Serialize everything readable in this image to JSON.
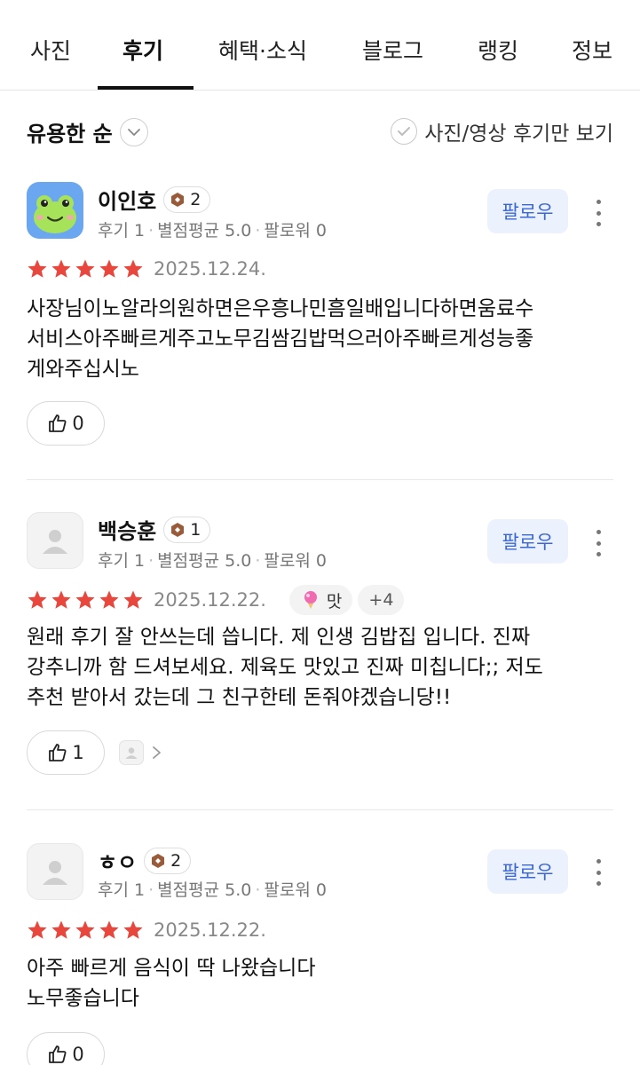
{
  "tabs": [
    {
      "label": "사진"
    },
    {
      "label": "후기"
    },
    {
      "label": "혜택·소식"
    },
    {
      "label": "블로그"
    },
    {
      "label": "랭킹"
    },
    {
      "label": "정보"
    }
  ],
  "active_tab": "후기",
  "sort": {
    "label": "유용한 순"
  },
  "photo_filter": {
    "label": "사진/영상 후기만 보기"
  },
  "follow_label": "팔로우",
  "colors": {
    "star": "#e8473e",
    "follow_bg": "#ebf1fd",
    "follow_text": "#3b67d6",
    "level_badge": "#9a5b3b"
  },
  "reviews": [
    {
      "name": "이인호",
      "level": "2",
      "meta": [
        "후기 1",
        "별점평균 5.0",
        "팔로워 0"
      ],
      "rating": 5,
      "date": "2025.12.24.",
      "keyword": "",
      "keyword_more": "",
      "text": "사장님이노알라의원하면은우흥나민흠일배입니다하면움료수\n서비스아주빠르게주고노무김쌈김밥먹으러아주빠르게성능좋\n게와주십시노",
      "likes": "0",
      "avatar": "frog-avatar"
    },
    {
      "name": "백승훈",
      "level": "1",
      "meta": [
        "후기 1",
        "별점평균 5.0",
        "팔로워 0"
      ],
      "rating": 5,
      "date": "2025.12.22.",
      "keyword": "맛",
      "keyword_more": "+4",
      "text": "원래 후기 잘 안쓰는데 씁니다. 제 인생 김밥집 입니다. 진짜\n강추니까 함 드셔보세요. 제육도 맛있고 진짜 미칩니다;; 저도\n추천 받아서 갔는데 그 친구한테 돈줘야겠습니당!!",
      "likes": "1",
      "avatar": "default-avatar"
    },
    {
      "name": "ㅎㅇ",
      "level": "2",
      "meta": [
        "후기 1",
        "별점평균 5.0",
        "팔로워 0"
      ],
      "rating": 5,
      "date": "2025.12.22.",
      "keyword": "",
      "keyword_more": "",
      "text": "아주 빠르게 음식이 딱 나왔습니다\n노무좋습니다",
      "likes": "0",
      "avatar": "default-avatar"
    }
  ]
}
